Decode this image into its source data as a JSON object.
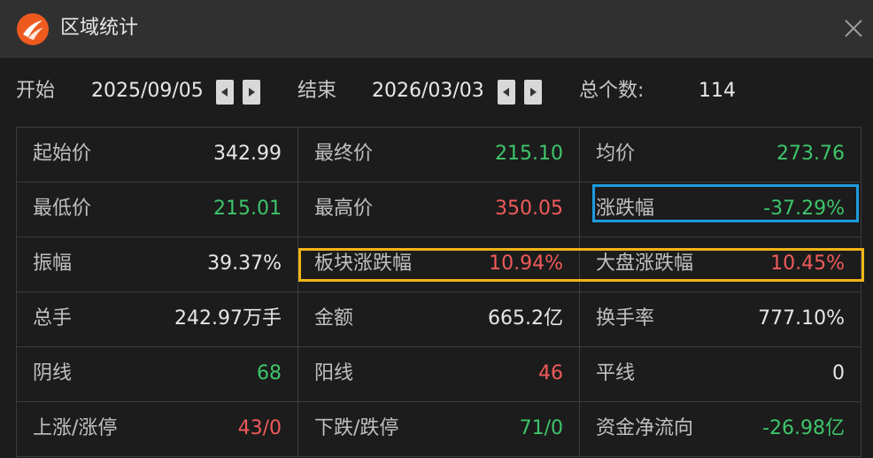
{
  "window": {
    "title": "区域统计"
  },
  "range": {
    "start_label": "开始",
    "start_date": "2025/09/05",
    "end_label": "结束",
    "end_date": "2026/03/03",
    "count_label": "总个数:",
    "count_value": "114"
  },
  "colors": {
    "up": "#f05a5a",
    "down": "#3ec56a",
    "highlight_blue": "#1e9bde",
    "highlight_yellow": "#f2b416"
  },
  "stats": {
    "rows": [
      [
        {
          "label": "起始价",
          "value": "342.99"
        },
        {
          "label": "最终价",
          "value": "215.10"
        },
        {
          "label": "均价",
          "value": "273.76"
        }
      ],
      [
        {
          "label": "最低价",
          "value": "215.01"
        },
        {
          "label": "最高价",
          "value": "350.05"
        },
        {
          "label": "涨跌幅",
          "value": "-37.29%"
        }
      ],
      [
        {
          "label": "振幅",
          "value": "39.37%"
        },
        {
          "label": "板块涨跌幅",
          "value": "10.94%"
        },
        {
          "label": "大盘涨跌幅",
          "value": "10.45%"
        }
      ],
      [
        {
          "label": "总手",
          "value": "242.97万手"
        },
        {
          "label": "金额",
          "value": "665.2亿"
        },
        {
          "label": "换手率",
          "value": "777.10%"
        }
      ],
      [
        {
          "label": "阴线",
          "value": "68"
        },
        {
          "label": "阳线",
          "value": "46"
        },
        {
          "label": "平线",
          "value": "0"
        }
      ],
      [
        {
          "label": "上涨/涨停",
          "value": "43/0"
        },
        {
          "label": "下跌/跌停",
          "value": "71/0"
        },
        {
          "label": "资金净流向",
          "value": "-26.98亿"
        }
      ]
    ]
  }
}
